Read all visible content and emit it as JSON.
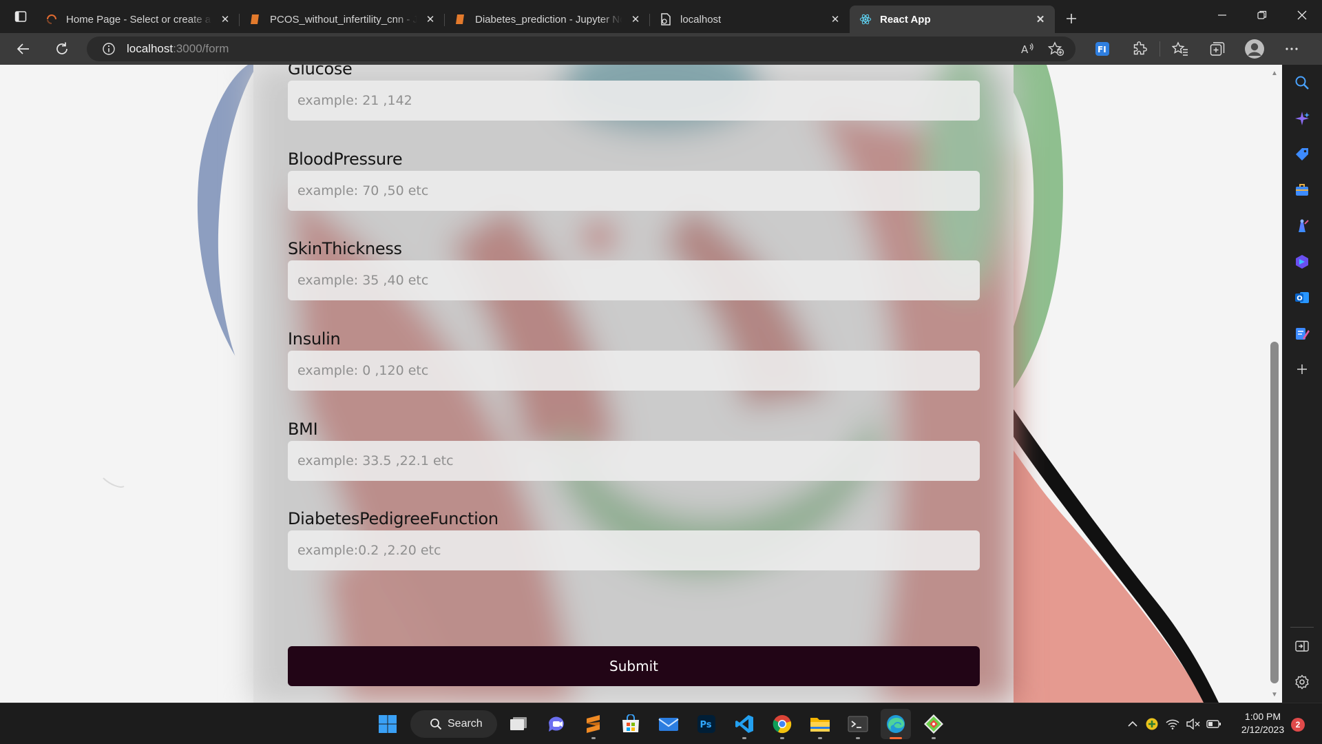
{
  "browser": {
    "tabs": [
      {
        "title": "Home Page - Select or create a n",
        "icon": "jupyter-spinner-icon",
        "active": false
      },
      {
        "title": "PCOS_without_infertility_cnn - Ju",
        "icon": "notebook-icon",
        "active": false
      },
      {
        "title": "Diabetes_prediction - Jupyter No",
        "icon": "notebook-icon",
        "active": false
      },
      {
        "title": "localhost",
        "icon": "page-icon",
        "active": false
      },
      {
        "title": "React App",
        "icon": "react-icon",
        "active": true
      }
    ],
    "address": {
      "host": "localhost",
      "path": ":3000/form"
    }
  },
  "form": {
    "fields": [
      {
        "label": "Glucose",
        "placeholder": "example: 21 ,142"
      },
      {
        "label": "BloodPressure",
        "placeholder": "example: 70 ,50 etc"
      },
      {
        "label": "SkinThickness",
        "placeholder": "example: 35 ,40 etc"
      },
      {
        "label": "Insulin",
        "placeholder": "example: 0 ,120 etc"
      },
      {
        "label": "BMI",
        "placeholder": "example: 33.5 ,22.1 etc"
      },
      {
        "label": "DiabetesPedigreeFunction",
        "placeholder": "example:0.2 ,2.20 etc"
      }
    ],
    "submit_label": "Submit"
  },
  "taskbar": {
    "search_label": "Search",
    "apps": [
      "start-icon",
      "task-view-icon",
      "teams-chat-icon",
      "sublime-text-icon",
      "microsoft-store-icon",
      "mail-icon",
      "photoshop-icon",
      "vscode-icon",
      "chrome-icon",
      "file-explorer-icon",
      "terminal-icon",
      "edge-icon",
      "git-icon"
    ],
    "ps_text": "Ps",
    "time": "1:00 PM",
    "date": "2/12/2023",
    "notification_count": "2"
  },
  "colors": {
    "submit_bg": "#220516",
    "panel_bg": "#cdcdcd",
    "edge_accent": "#2f7fe0"
  }
}
